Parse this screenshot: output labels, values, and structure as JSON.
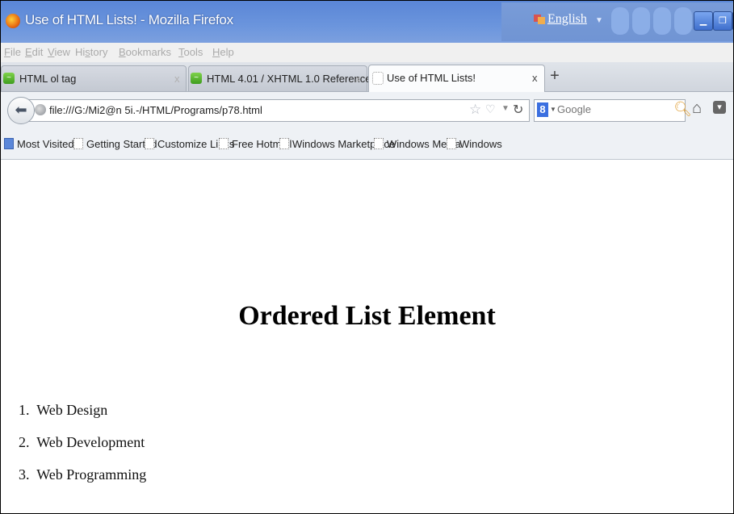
{
  "window": {
    "title": "Use of HTML Lists! - Mozilla Firefox",
    "language": "English"
  },
  "menu": [
    {
      "accel": "F",
      "rest": "ile"
    },
    {
      "accel": "E",
      "rest": "dit"
    },
    {
      "accel": "V",
      "rest": "iew"
    },
    {
      "accel": "",
      "rest": "Hi",
      "accel2": "s",
      "rest2": "tory"
    },
    {
      "accel": "B",
      "rest": "ookmarks"
    },
    {
      "accel": "T",
      "rest": "ools"
    },
    {
      "accel": "H",
      "rest": "elp"
    }
  ],
  "tabs": [
    {
      "label": "HTML ol tag",
      "close": "x"
    },
    {
      "label": "HTML 4.01 / XHTML 1.0 Reference",
      "close": "x"
    },
    {
      "label": "Use of HTML Lists!",
      "close": "x"
    }
  ],
  "new_tab": "+",
  "navbar": {
    "url": "file:///G:/Mi2@n 5i.-/HTML/Programs/p78.html",
    "search_placeholder": "Google",
    "search_engine_letter": "8"
  },
  "bookmarks": [
    "Most Visited",
    "Getting Started",
    "Customize Links",
    "Free Hotmail",
    "Windows Marketplace",
    "Windows Media",
    "Windows"
  ],
  "page": {
    "heading": "Ordered List Element",
    "items": [
      {
        "num": "1.",
        "text": "Web Design"
      },
      {
        "num": "2.",
        "text": "Web Development"
      },
      {
        "num": "3.",
        "text": "Web Programming"
      }
    ]
  },
  "colors": {
    "titlebar": "#6b95dd",
    "tab_active": "#fbfcfd",
    "chrome_bg": "#eef1f5"
  }
}
